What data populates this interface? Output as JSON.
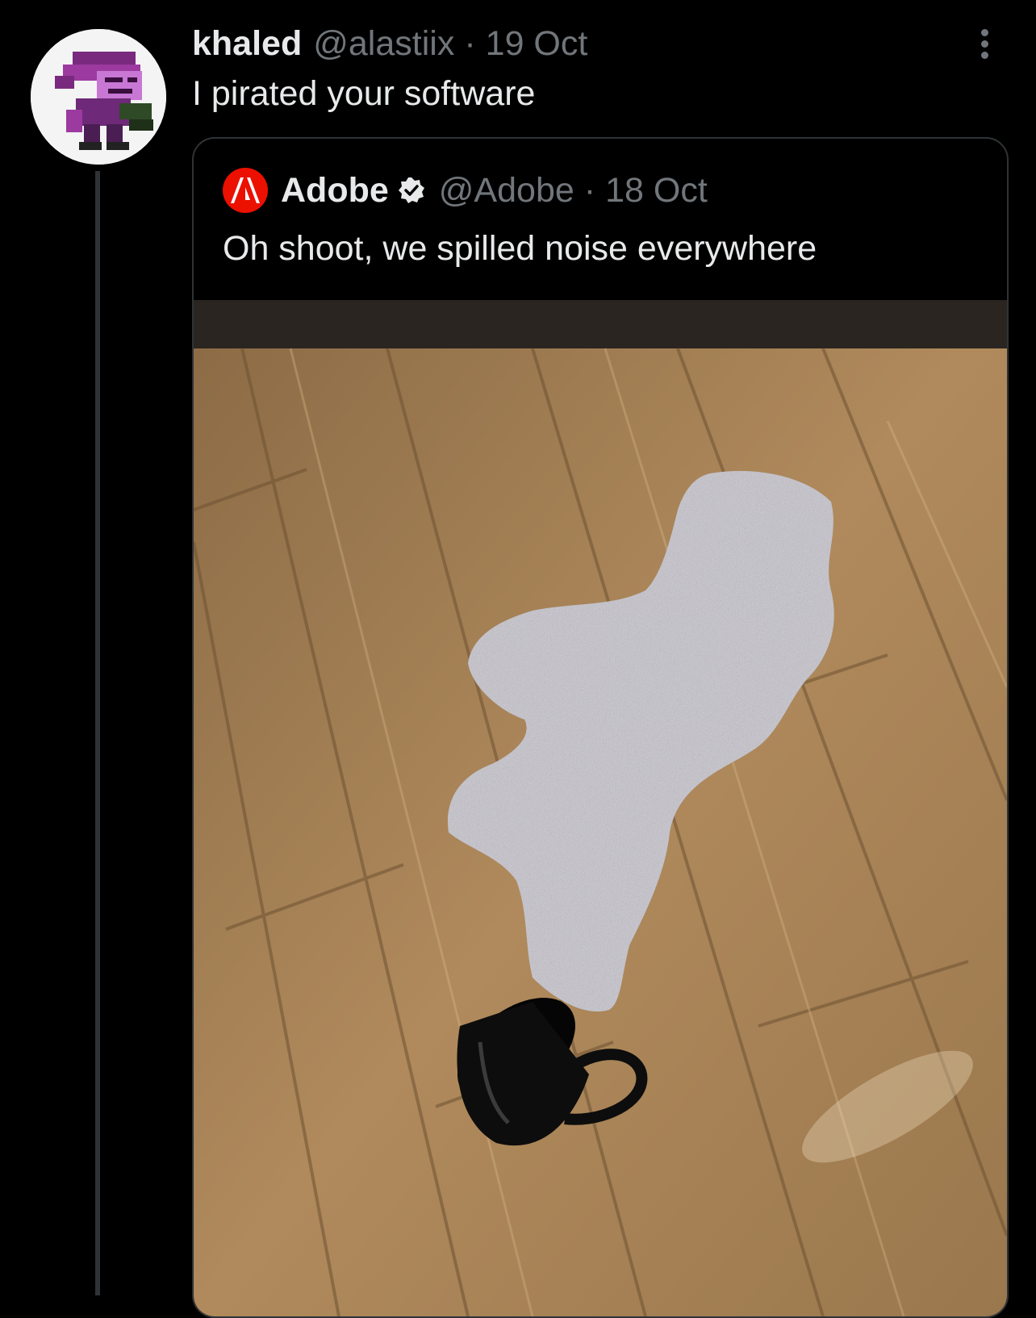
{
  "colors": {
    "background": "#000000",
    "primary_text": "#e7e9ea",
    "secondary_text": "#71767b",
    "divider": "#2f3336",
    "adobe_red": "#eb1000"
  },
  "reply": {
    "display_name": "khaled",
    "handle": "@alastiix",
    "separator": "·",
    "date": "19 Oct",
    "text": "I pirated your software",
    "avatar_icon": "pixel-art-character-avatar",
    "more_icon": "more-vertical-icon"
  },
  "quoted_tweet": {
    "display_name": "Adobe",
    "verified_icon": "verified-badge-icon",
    "handle": "@Adobe",
    "separator": "·",
    "date": "18 Oct",
    "text": "Oh shoot, we spilled noise everywhere",
    "logo_icon": "adobe-logo-icon",
    "media_icon": "photo-spilled-mug-noise-on-wood-floor"
  }
}
